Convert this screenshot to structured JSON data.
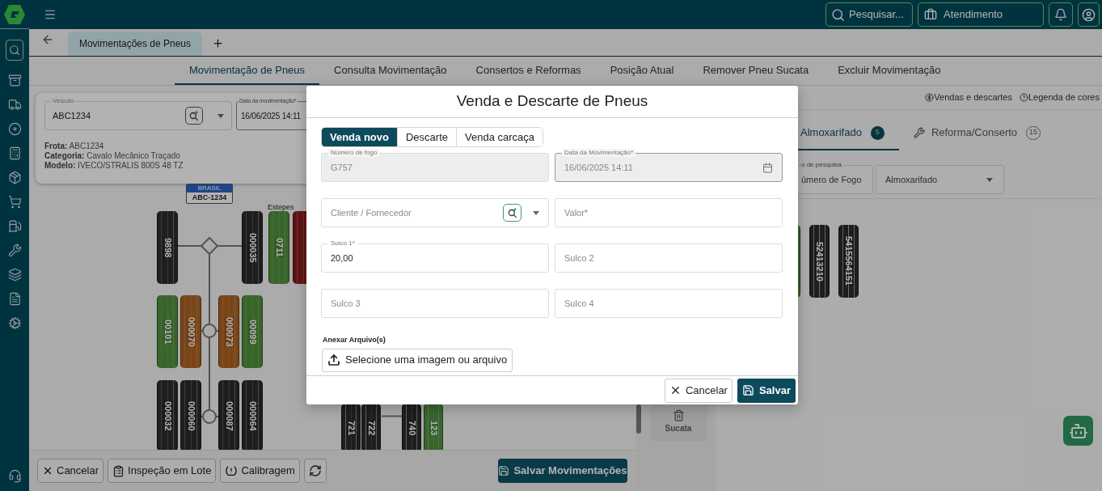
{
  "topbar": {
    "search_button": "Pesquisar...",
    "service_button": "Atendimento"
  },
  "doc_tabs": [
    {
      "label": "Movimentações de Pneus",
      "selected": true
    }
  ],
  "nav_tabs": [
    {
      "label": "Movimentação de Pneus",
      "selected": true
    },
    {
      "label": "Consulta Movimentação",
      "selected": false
    },
    {
      "label": "Consertos e Reformas",
      "selected": false
    },
    {
      "label": "Posição Atual",
      "selected": false
    },
    {
      "label": "Remover Pneu Sucata",
      "selected": false
    },
    {
      "label": "Excluir Movimentação",
      "selected": false
    }
  ],
  "vehicle_card": {
    "vehicle_field": {
      "label": "Veículo",
      "value": "ABC1234"
    },
    "date_field": {
      "label": "Data da movimentação*",
      "value": "16/06/2025 14:11"
    },
    "info": [
      {
        "label": "Frota:",
        "value": "ABC1234"
      },
      {
        "label": "Categoria:",
        "value": "Cavalo Mecânico Traçado"
      },
      {
        "label": "Modelo:",
        "value": "IVECO/STRALIS 800S 48 TZ"
      }
    ]
  },
  "diagram": {
    "plate": {
      "country": "BRASIL",
      "number": "ABC-1234"
    },
    "spares_label": "Estepes",
    "tires": [
      {
        "number": "9898",
        "color": "#1e1e1e"
      },
      {
        "number": "000035",
        "color": "#1e1e1e"
      },
      {
        "number": "0711",
        "color": "#37662a"
      },
      {
        "color": "#611414"
      },
      {
        "number": "00101",
        "color": "#37662a"
      },
      {
        "number": "000070",
        "color": "#7b4516"
      },
      {
        "number": "000073",
        "color": "#7b4516"
      },
      {
        "number": "00099",
        "color": "#37662a"
      },
      {
        "number": "000032",
        "color": "#1e1e1e"
      },
      {
        "number": "000060",
        "color": "#1e1e1e"
      },
      {
        "number": "000087",
        "color": "#1e1e1e"
      },
      {
        "number": "000064",
        "color": "#1e1e1e"
      },
      {
        "number": "721",
        "color": "#1e1e1e"
      },
      {
        "number": "722",
        "color": "#1e1e1e"
      },
      {
        "number": "740",
        "color": "#1e1e1e"
      },
      {
        "number": "123",
        "color": "#37662a"
      }
    ]
  },
  "bottom_bar": {
    "buttons": [
      {
        "kind": "cancel",
        "label": "Cancelar"
      },
      {
        "kind": "batch",
        "label": "Inspeção em Lote"
      },
      {
        "kind": "pressure",
        "label": "Calibragem"
      },
      {
        "kind": "refresh"
      }
    ],
    "save_button": "Salvar Movimentações"
  },
  "scrap_bin": "Sucata",
  "right_panel": {
    "links": [
      {
        "kind": "sales",
        "label": "Vendas e descartes"
      },
      {
        "kind": "legend",
        "label": "Legenda de cores"
      }
    ],
    "tabs": [
      {
        "label": "Almoxarifado",
        "count": "5",
        "selected": true
      },
      {
        "label": "Reforma/Conserto",
        "count": "15",
        "selected": false
      }
    ],
    "filters": [
      {
        "label": "o de pesquisa",
        "value": "úmero de Fogo"
      },
      {
        "value": "Almoxarifado"
      }
    ],
    "tires": [
      {
        "color": "#37662a"
      },
      {
        "number": "52413210",
        "color": "#1e1e1e"
      },
      {
        "number": "5415564151",
        "color": "#1e1e1e"
      }
    ]
  },
  "modal": {
    "title": "Venda e Descarte de Pneus",
    "tabs": [
      {
        "label": "Venda novo",
        "selected": true
      },
      {
        "label": "Descarte",
        "selected": false
      },
      {
        "label": "Venda carcaça",
        "selected": false
      }
    ],
    "fields": [
      {
        "kind": "text",
        "label": "Número de fogo",
        "value": "G757",
        "disabled": true
      },
      {
        "kind": "date",
        "label": "Data da Movimentação*",
        "value": "16/06/2025 14:11",
        "disabled": true
      },
      {
        "kind": "lookup",
        "placeholder": "Cliente / Fornecedor",
        "disabled": false
      },
      {
        "kind": "text",
        "placeholder": "Valor*",
        "disabled": false
      },
      {
        "kind": "text",
        "label": "Sulco 1*",
        "value": "20,00",
        "disabled": false
      },
      {
        "kind": "text",
        "placeholder": "Sulco 2",
        "disabled": false
      },
      {
        "kind": "text",
        "placeholder": "Sulco 3",
        "disabled": false
      },
      {
        "kind": "text",
        "placeholder": "Sulco 4",
        "disabled": false
      }
    ],
    "attach_label": "Anexar Arquivo(s)",
    "upload_button": "Selecione uma imagem ou arquivo",
    "cancel_button": "Cancelar",
    "save_button": "Salvar"
  }
}
